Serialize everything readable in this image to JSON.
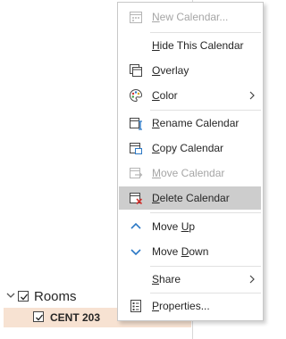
{
  "folders": {
    "group_label": "Rooms",
    "group_checked": true,
    "calendar_label": "CENT 203",
    "calendar_checked": true,
    "calendar_color": "#f7e2d2"
  },
  "menu": {
    "items": [
      {
        "label": "New Calendar...",
        "accel": "N",
        "rest": "ew Calendar...",
        "enabled": false,
        "icon": "new-calendar-icon"
      },
      {
        "label": "Hide This Calendar",
        "accel": "H",
        "rest": "ide This Calendar",
        "enabled": true,
        "icon": ""
      },
      {
        "label": "Overlay",
        "accel": "O",
        "rest": "verlay",
        "enabled": true,
        "icon": "overlay-icon"
      },
      {
        "label": "Color",
        "accel": "C",
        "rest": "olor",
        "enabled": true,
        "icon": "palette-icon",
        "submenu": true
      },
      {
        "label": "Rename Calendar",
        "accel": "R",
        "rest": "ename Calendar",
        "enabled": true,
        "icon": "rename-calendar-icon"
      },
      {
        "label": "Copy Calendar",
        "accel": "C",
        "rest": "opy Calendar",
        "enabled": true,
        "icon": "copy-calendar-icon"
      },
      {
        "label": "Move Calendar",
        "accel": "M",
        "rest": "ove Calendar",
        "enabled": false,
        "icon": "move-calendar-icon"
      },
      {
        "label": "Delete Calendar",
        "accel": "D",
        "rest": "elete Calendar",
        "enabled": true,
        "icon": "delete-calendar-icon",
        "highlighted": true
      },
      {
        "label": "Move Up",
        "pre": "Move ",
        "accel": "U",
        "rest": "p",
        "enabled": true,
        "icon": "chevron-up-icon"
      },
      {
        "label": "Move Down",
        "pre": "Move ",
        "accel": "D",
        "rest": "own",
        "enabled": true,
        "icon": "chevron-down-icon"
      },
      {
        "label": "Share",
        "accel": "S",
        "rest": "hare",
        "enabled": true,
        "icon": "",
        "submenu": true
      },
      {
        "label": "Properties...",
        "accel": "P",
        "rest": "roperties...",
        "enabled": true,
        "icon": "properties-icon"
      }
    ]
  },
  "colors": {
    "highlight": "#cdcdcd",
    "accent_blue": "#2b78c5",
    "delete_red": "#d0312d",
    "disabled": "#a6a6a6"
  }
}
